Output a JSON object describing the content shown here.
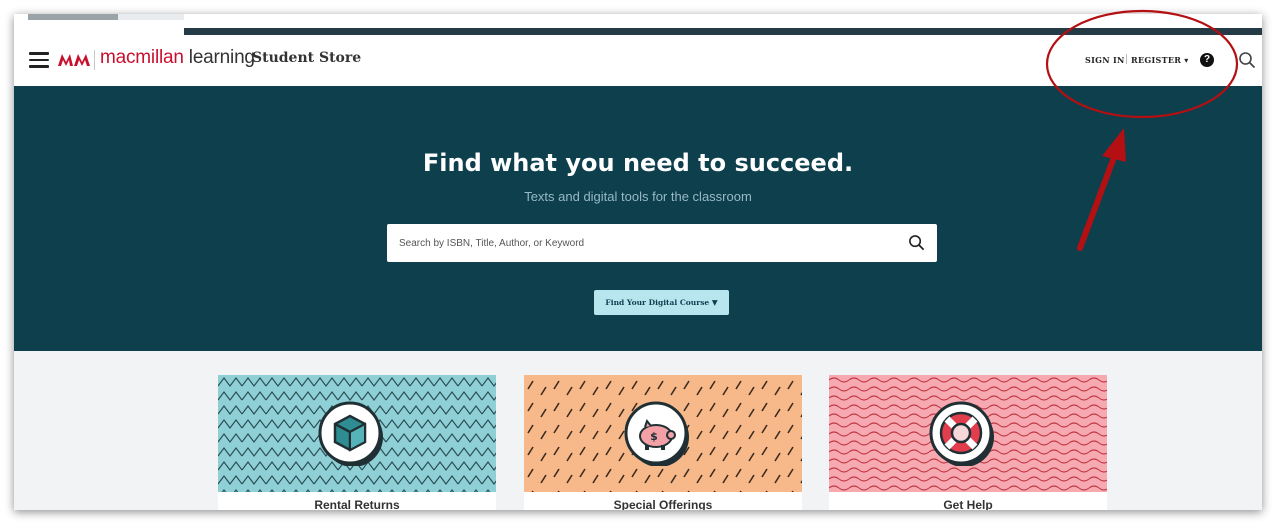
{
  "header": {
    "brand_prefix": "macmillan",
    "brand_suffix": " learning",
    "store_name": "Student Store",
    "sign_in": "SIGN IN",
    "register": "REGISTER ▾",
    "help_glyph": "?"
  },
  "hero": {
    "title": "Find what you need to succeed.",
    "subtitle": "Texts and digital tools for the classroom",
    "search_placeholder": "Search by ISBN, Title, Author, or Keyword",
    "course_button": "Find Your Digital Course ▼"
  },
  "cards": [
    {
      "title": "Rental Returns",
      "icon": "box-icon"
    },
    {
      "title": "Special Offerings",
      "icon": "piggy-bank-icon"
    },
    {
      "title": "Get Help",
      "icon": "lifebuoy-icon"
    }
  ],
  "colors": {
    "hero_bg": "#0d3f4d",
    "brand_red": "#c8102e",
    "course_button_bg": "#b7e6ef",
    "annotation_red": "#b40f12"
  }
}
